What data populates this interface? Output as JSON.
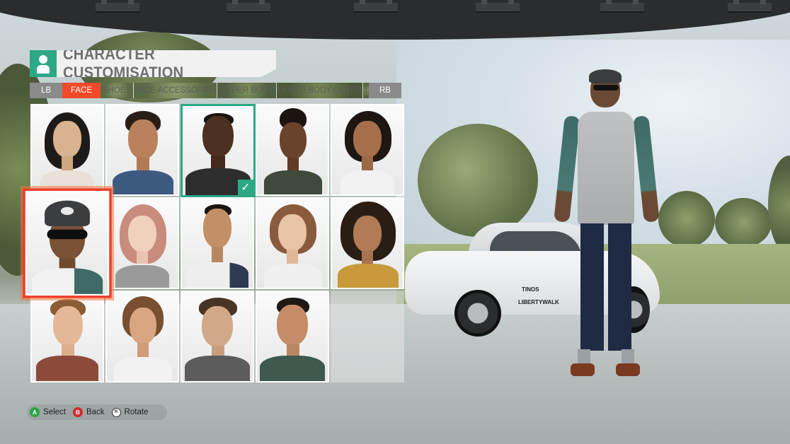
{
  "header": {
    "title": "CHARACTER CUSTOMISATION",
    "icon": "person-icon",
    "accent": "#2ca884"
  },
  "tabs": {
    "left_bumper": "LB",
    "right_bumper": "RB",
    "items": [
      {
        "label": "FACE",
        "active": true
      },
      {
        "label": "SHOES",
        "active": false
      },
      {
        "label": "FACE ACCESSORIES",
        "active": false
      },
      {
        "label": "UPPER BODY",
        "active": false
      },
      {
        "label": "UPPER BODY OUTER",
        "active": false
      },
      {
        "label": "L",
        "active": false
      }
    ],
    "active_color": "#f04a2a"
  },
  "grid": {
    "rows": 3,
    "cols": 5,
    "equipped_index": 2,
    "selected_index": 5,
    "empty_index": 14
  },
  "hints": {
    "select_key": "A",
    "select_label": "Select",
    "back_key": "B",
    "back_label": "Back",
    "rotate_key": "R",
    "rotate_label": "Rotate"
  },
  "car_decals": [
    "TINOS",
    "LIBERTYWALK"
  ]
}
